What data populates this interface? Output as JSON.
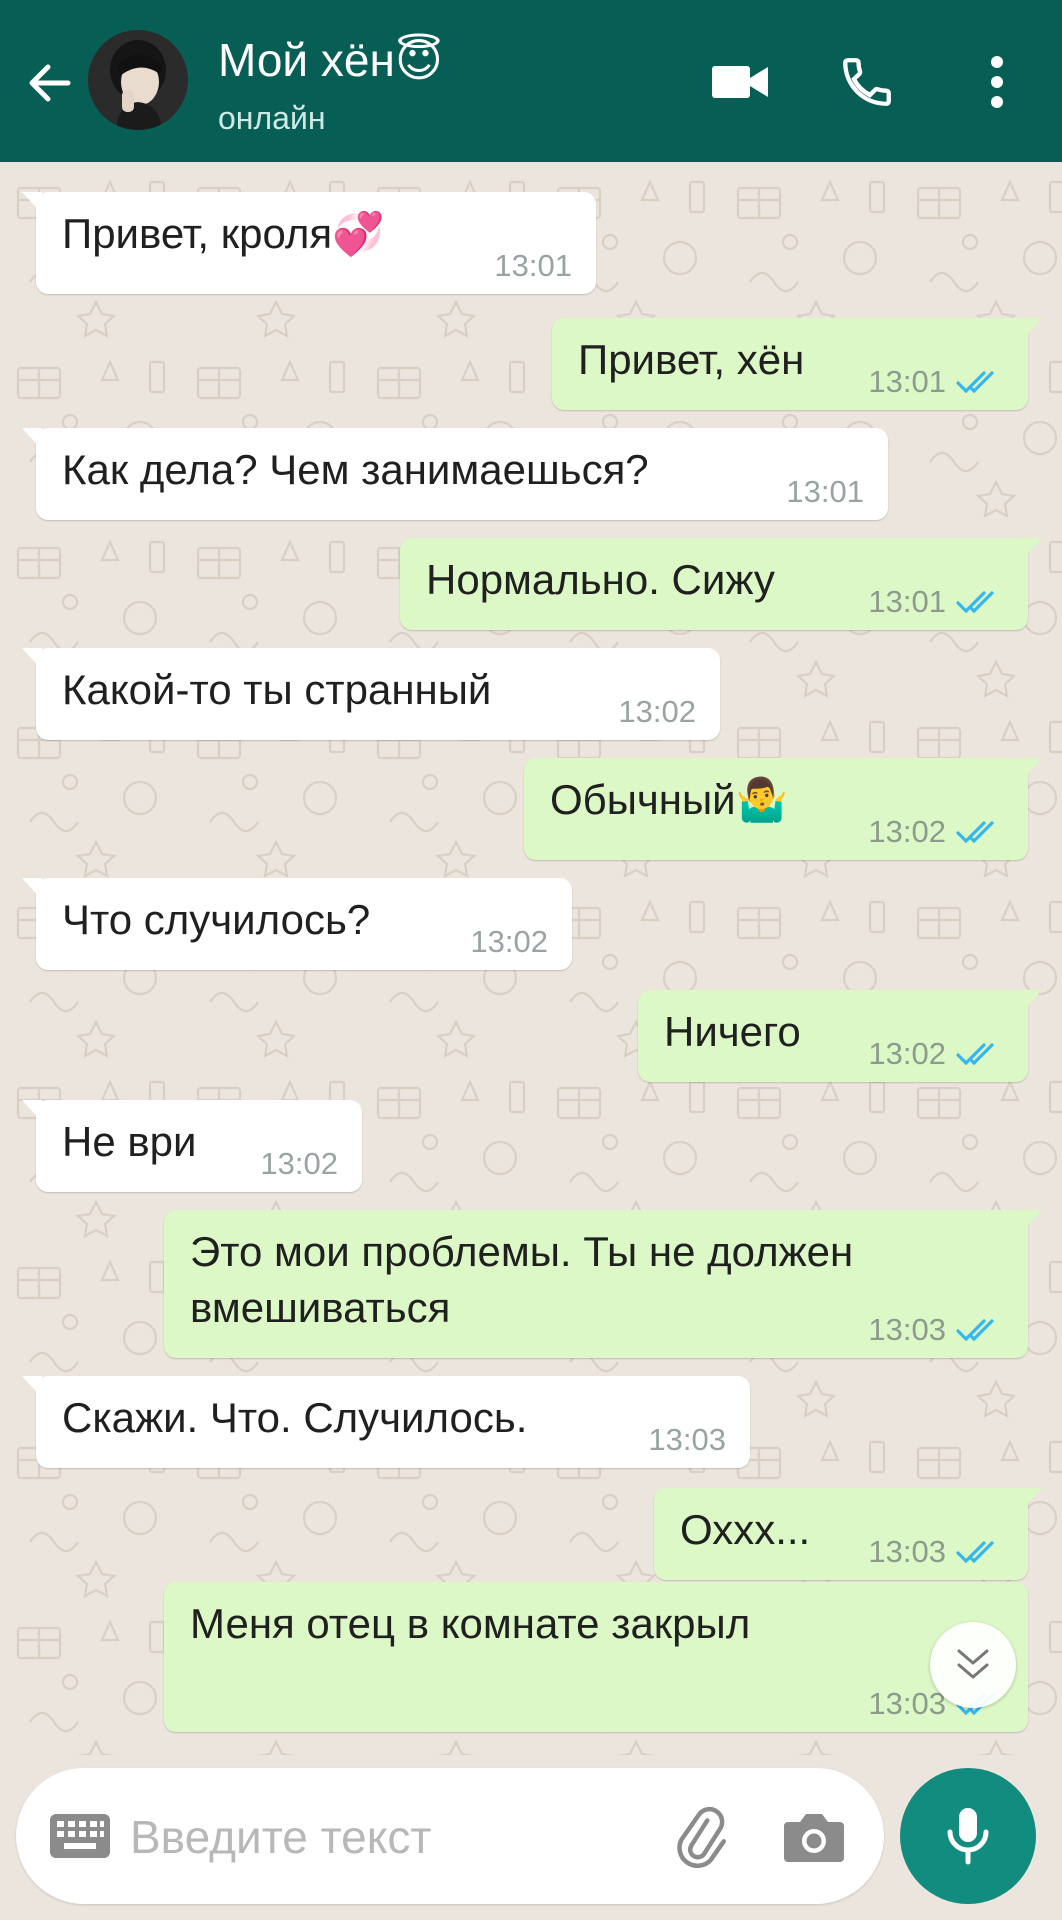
{
  "header": {
    "contact_name": "Мой хён😇",
    "status": "онлайн"
  },
  "icons": {
    "back": "arrow-left-icon",
    "video": "video-camera-icon",
    "call": "phone-icon",
    "menu": "more-vert-icon",
    "keyboard": "keyboard-icon",
    "attach": "paperclip-icon",
    "camera": "camera-icon",
    "mic": "microphone-icon",
    "scroll": "chevron-double-down-icon",
    "read": "double-check-icon"
  },
  "colors": {
    "header": "#075e54",
    "incoming_bubble": "#ffffff",
    "outgoing_bubble": "#dcf8c6",
    "read_tick": "#34b7f1",
    "mic_button": "#128c7e",
    "wallpaper": "#ece5dd"
  },
  "messages": [
    {
      "dir": "in",
      "text": "Привет, кроля💞",
      "time": "13:01"
    },
    {
      "dir": "out",
      "text": "Привет, хён",
      "time": "13:01",
      "status": "read"
    },
    {
      "dir": "in",
      "text": "Как дела? Чем занимаешься?",
      "time": "13:01"
    },
    {
      "dir": "out",
      "text": "Нормально. Сижу",
      "time": "13:01",
      "status": "read"
    },
    {
      "dir": "in",
      "text": "Какой-то ты странный",
      "time": "13:02"
    },
    {
      "dir": "out",
      "text": "Обычный🤷‍♂️",
      "time": "13:02",
      "status": "read"
    },
    {
      "dir": "in",
      "text": "Что случилось?",
      "time": "13:02"
    },
    {
      "dir": "out",
      "text": "Ничего",
      "time": "13:02",
      "status": "read"
    },
    {
      "dir": "in",
      "text": "Не ври",
      "time": "13:02"
    },
    {
      "dir": "out",
      "text": "Это мои проблемы. Ты не должен\nвмешиваться",
      "time": "13:03",
      "status": "read"
    },
    {
      "dir": "in",
      "text": "Скажи. Что. Случилось.",
      "time": "13:03"
    },
    {
      "dir": "out",
      "text": "Оххх...",
      "time": "13:03",
      "status": "read"
    },
    {
      "dir": "out",
      "text": "Меня отец в комнате закрыл",
      "time": "13:03",
      "status": "read"
    }
  ],
  "input": {
    "placeholder": "Введите текст",
    "value": ""
  }
}
